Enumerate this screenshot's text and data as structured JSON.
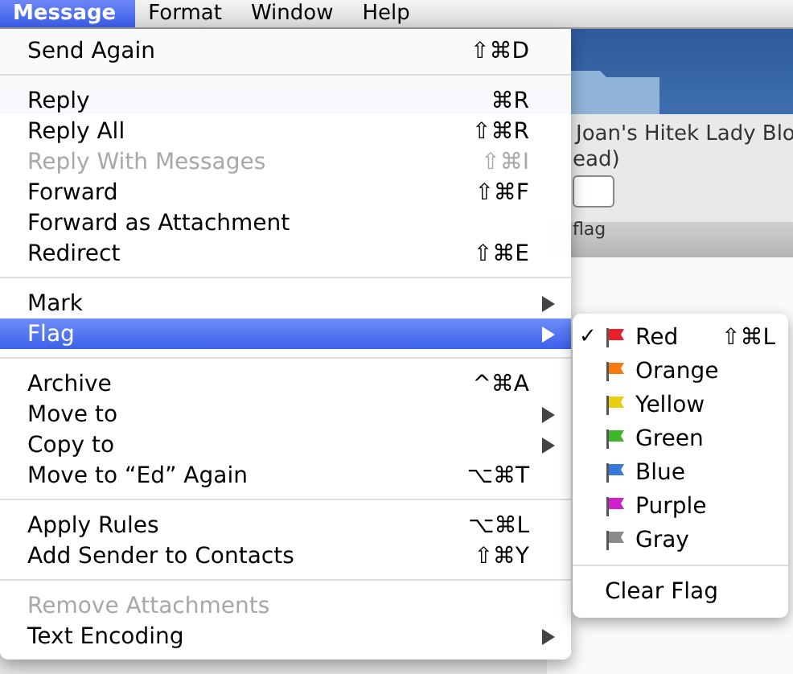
{
  "menubar": [
    {
      "label": "Message",
      "selected": true
    },
    {
      "label": "Format",
      "selected": false
    },
    {
      "label": "Window",
      "selected": false
    },
    {
      "label": "Help",
      "selected": false
    }
  ],
  "background": {
    "title_fragment": "Joan's Hitek Lady Blo",
    "count_fragment": "ead)",
    "toolbar_label": "flag"
  },
  "menu": {
    "sections": [
      [
        {
          "label": "Send Again",
          "shortcut": "⇧⌘D",
          "disabled": false,
          "submenu": false,
          "selected": false
        }
      ],
      [
        {
          "label": "Reply",
          "shortcut": "⌘R",
          "disabled": false,
          "submenu": false,
          "selected": false
        },
        {
          "label": "Reply All",
          "shortcut": "⇧⌘R",
          "disabled": false,
          "submenu": false,
          "selected": false
        },
        {
          "label": "Reply With Messages",
          "shortcut": "⇧⌘I",
          "disabled": true,
          "submenu": false,
          "selected": false
        },
        {
          "label": "Forward",
          "shortcut": "⇧⌘F",
          "disabled": false,
          "submenu": false,
          "selected": false
        },
        {
          "label": "Forward as Attachment",
          "disabled": false,
          "submenu": false,
          "selected": false
        },
        {
          "label": "Redirect",
          "shortcut": "⇧⌘E",
          "disabled": false,
          "submenu": false,
          "selected": false
        }
      ],
      [
        {
          "label": "Mark",
          "disabled": false,
          "submenu": true,
          "selected": false
        },
        {
          "label": "Flag",
          "disabled": false,
          "submenu": true,
          "selected": true
        }
      ],
      [
        {
          "label": "Archive",
          "shortcut": "^⌘A",
          "disabled": false,
          "submenu": false,
          "selected": false
        },
        {
          "label": "Move to",
          "disabled": false,
          "submenu": true,
          "selected": false
        },
        {
          "label": "Copy to",
          "disabled": false,
          "submenu": true,
          "selected": false
        },
        {
          "label": "Move to “Ed” Again",
          "shortcut": "⌥⌘T",
          "disabled": false,
          "submenu": false,
          "selected": false
        }
      ],
      [
        {
          "label": "Apply Rules",
          "shortcut": "⌥⌘L",
          "disabled": false,
          "submenu": false,
          "selected": false
        },
        {
          "label": "Add Sender to Contacts",
          "shortcut": "⇧⌘Y",
          "disabled": false,
          "submenu": false,
          "selected": false
        }
      ],
      [
        {
          "label": "Remove Attachments",
          "disabled": true,
          "submenu": false,
          "selected": false
        },
        {
          "label": "Text Encoding",
          "disabled": false,
          "submenu": true,
          "selected": false
        }
      ]
    ]
  },
  "flag_submenu": {
    "check_glyph": "✓",
    "flags": [
      {
        "label": "Red",
        "color": "#e8202a",
        "checked": true,
        "shortcut": "⇧⌘L"
      },
      {
        "label": "Orange",
        "color": "#f47a14",
        "checked": false
      },
      {
        "label": "Yellow",
        "color": "#e8d010",
        "checked": false
      },
      {
        "label": "Green",
        "color": "#3fb52a",
        "checked": false
      },
      {
        "label": "Blue",
        "color": "#3a78d8",
        "checked": false
      },
      {
        "label": "Purple",
        "color": "#d020c8",
        "checked": false
      },
      {
        "label": "Gray",
        "color": "#8a8a8a",
        "checked": false
      }
    ],
    "clear": {
      "label": "Clear Flag"
    }
  }
}
